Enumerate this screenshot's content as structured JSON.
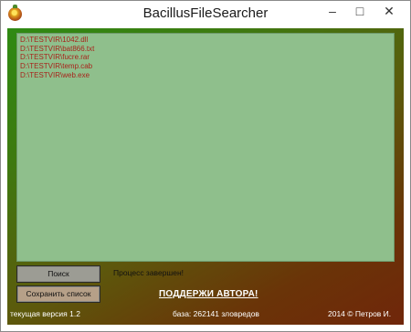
{
  "window": {
    "title": "BacillusFileSearcher",
    "controls": {
      "minimize": "–",
      "maximize": "□",
      "close": "✕"
    },
    "icon": "bacillus-app-icon"
  },
  "results": [
    "D:\\TESTVIR\\1042.dll",
    "D:\\TESTVIR\\bat866.txt",
    "D:\\TESTVIR\\fucre.rar",
    "D:\\TESTVIR\\temp.cab",
    "D:\\TESTVIR\\web.exe"
  ],
  "buttons": {
    "search": "Поиск",
    "save_list": "Сохранить список"
  },
  "status": "Процесс завершен!",
  "support_link": "ПОДДЕРЖИ АВТОРА!",
  "footer": {
    "version": "текущая версия 1.2",
    "base": "база: 262141 зловредов",
    "copyright": "2014 © Петров И."
  },
  "colors": {
    "list_background": "#8fbf8c",
    "result_text": "#a8231b",
    "gradient_start": "#2f8a13",
    "gradient_end": "#70260a"
  }
}
